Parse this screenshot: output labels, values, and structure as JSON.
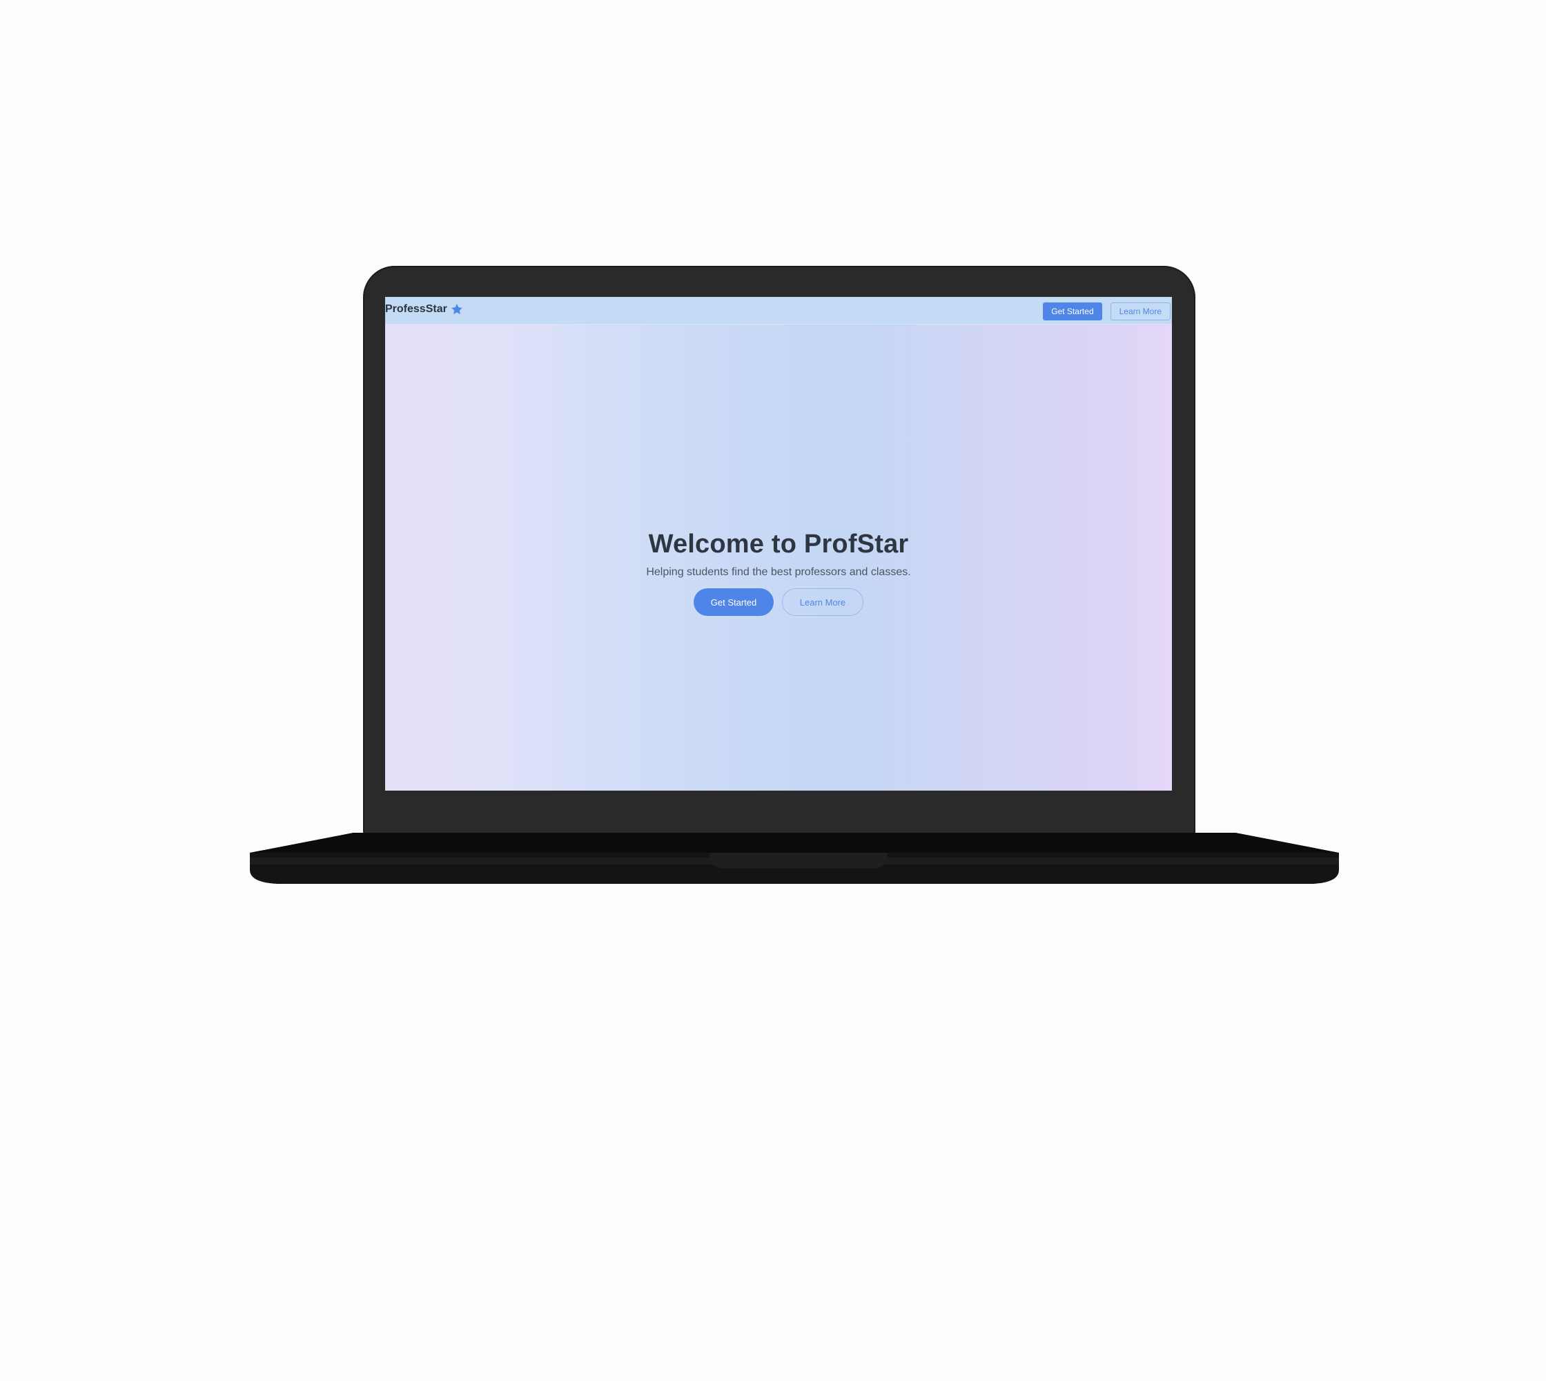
{
  "navbar": {
    "brand": "ProfessStar",
    "brand_icon": "star-icon",
    "get_started_label": "Get Started",
    "learn_more_label": "Learn More"
  },
  "hero": {
    "title": "Welcome to ProfStar",
    "subtitle": "Helping students find the best professors and classes.",
    "get_started_label": "Get Started",
    "learn_more_label": "Learn More"
  },
  "colors": {
    "accent": "#4f85e6",
    "navbar_bg": "#c4dbf6",
    "title_text": "#2e3642",
    "laptop_body": "#2a2a2a"
  }
}
